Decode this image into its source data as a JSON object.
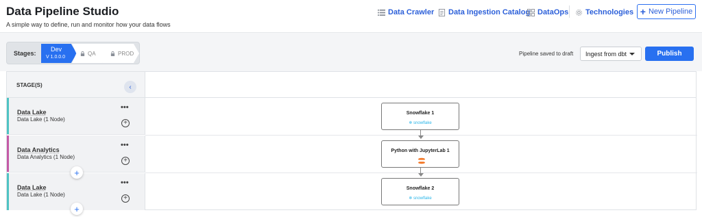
{
  "app": {
    "title": "Data Pipeline Studio",
    "subtitle": "A simple way to define, run and monitor how your data flows"
  },
  "nav": {
    "items": [
      {
        "label": "Data Crawler",
        "icon": "list-icon"
      },
      {
        "label": "Data Ingestion Catalog",
        "icon": "document-icon"
      },
      {
        "label": "DataOps",
        "icon": "grid-icon"
      },
      {
        "label": "Technologies",
        "icon": "gear-icon"
      }
    ],
    "new_pipeline_label": "New Pipeline"
  },
  "toolbar": {
    "stages_label": "Stages:",
    "stages": [
      {
        "name": "Dev",
        "version": "V 1.0.0.0",
        "active": true
      },
      {
        "name": "QA",
        "locked": true
      },
      {
        "name": "PROD",
        "locked": true
      }
    ],
    "saved_status": "Pipeline saved to draft",
    "ingest_select": "Ingest from dbt",
    "publish_label": "Publish"
  },
  "pipeline": {
    "header": "STAGE(S)",
    "rows": [
      {
        "name": "Data Lake",
        "sub": "Data Lake (1 Node)",
        "color": "#4ec3c3"
      },
      {
        "name": "Data Analytics",
        "sub": "Data Analytics (1 Node)",
        "color": "#c45aa6"
      },
      {
        "name": "Data Lake",
        "sub": "Data Lake (1 Node)",
        "color": "#4ec3c3"
      }
    ],
    "nodes": [
      {
        "title": "Snowflake 1",
        "logo": "snowflake"
      },
      {
        "title": "Python with JupyterLab 1",
        "logo": "jupyter"
      },
      {
        "title": "Snowflake 2",
        "logo": "snowflake"
      }
    ],
    "more_label": "•••",
    "add_label": "+"
  },
  "colors": {
    "accent": "#2870f0",
    "link": "#2b5fd9"
  }
}
